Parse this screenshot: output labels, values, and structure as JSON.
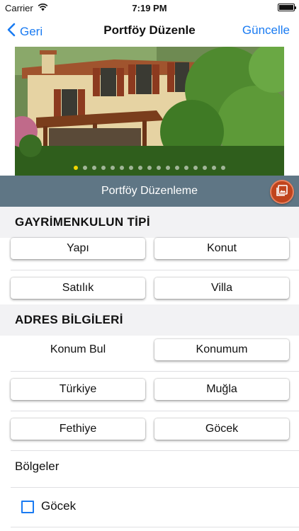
{
  "status_bar": {
    "carrier": "Carrier",
    "time": "7:19 PM"
  },
  "nav": {
    "back_label": "Geri",
    "title": "Portföy Düzenle",
    "action_label": "Güncelle"
  },
  "photo": {
    "page_count": 17,
    "current_page": 1
  },
  "banner": {
    "title": "Portföy Düzenleme"
  },
  "property_type": {
    "header": "GAYRİMENKULUN TİPİ",
    "rows": [
      {
        "left": "Yapı",
        "right": "Konut"
      },
      {
        "left": "Satılık",
        "right": "Villa"
      }
    ]
  },
  "address": {
    "header": "ADRES BİLGİLERİ",
    "locate_label": "Konum Bul",
    "my_location_label": "Konumum",
    "country": "Türkiye",
    "city": "Muğla",
    "district": "Fethiye",
    "neighborhood": "Göcek"
  },
  "regions": {
    "label": "Bölgeler",
    "items": [
      {
        "label": "Göcek",
        "checked": false
      }
    ]
  },
  "colors": {
    "accent": "#1a7bf2",
    "banner": "#5f7685",
    "fab": "#c0441d",
    "section_bg": "#f2f2f4"
  },
  "icons": {
    "wifi": "wifi-icon",
    "battery": "battery-icon",
    "back": "chevron-left-icon",
    "gallery": "gallery-icon"
  }
}
